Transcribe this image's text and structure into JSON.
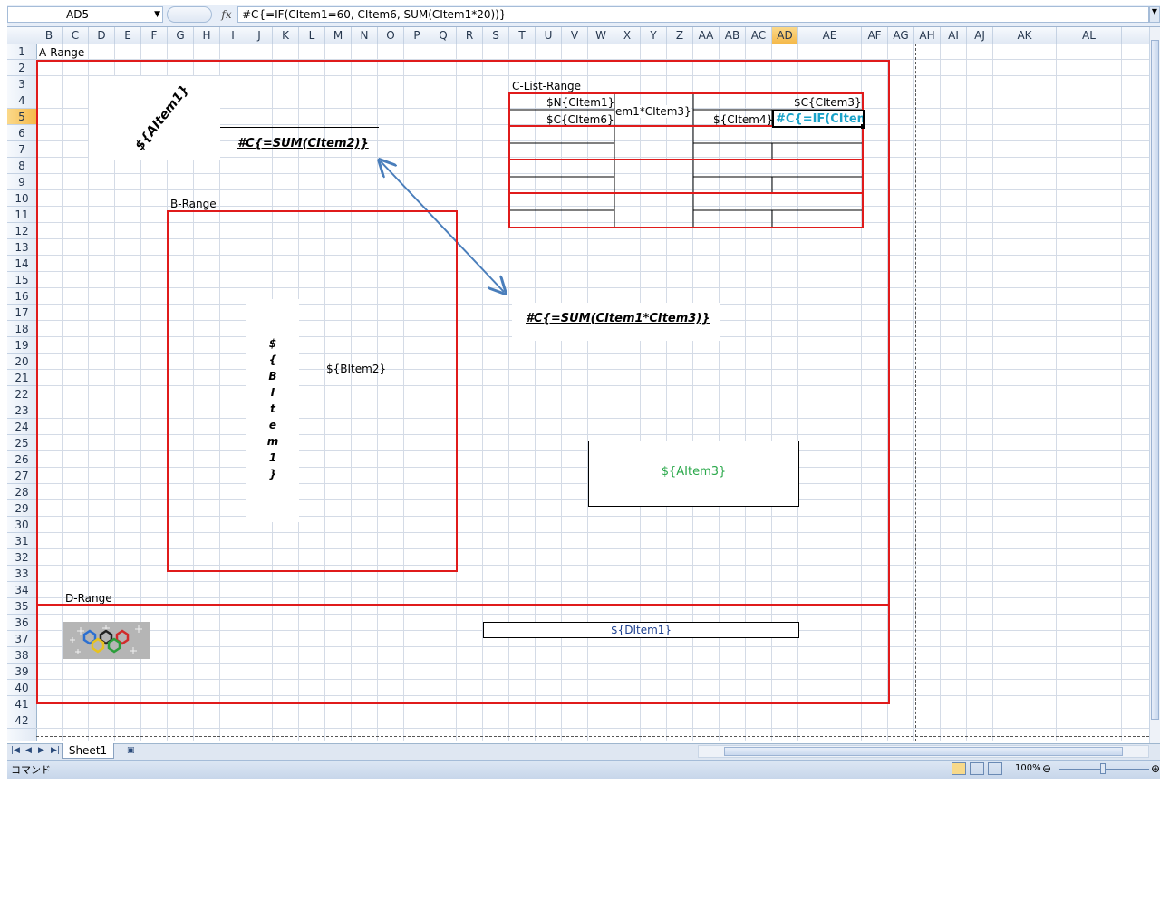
{
  "formula_bar": {
    "name_box": "AD5",
    "fx": "fx",
    "formula": "#C{=IF(CItem1=60, CItem6, SUM(CItem1*20))}"
  },
  "columns": [
    "B",
    "C",
    "D",
    "E",
    "F",
    "G",
    "H",
    "I",
    "J",
    "K",
    "L",
    "M",
    "N",
    "O",
    "P",
    "Q",
    "R",
    "S",
    "T",
    "U",
    "V",
    "W",
    "X",
    "Y",
    "Z",
    "AA",
    "AB",
    "AC",
    "AD",
    "AE",
    "AF",
    "AG",
    "AH",
    "AI",
    "AJ",
    "AK",
    "AL"
  ],
  "selected_column": "AD",
  "rows": [
    "1",
    "2",
    "3",
    "4",
    "5",
    "6",
    "7",
    "8",
    "9",
    "10",
    "11",
    "12",
    "13",
    "14",
    "15",
    "16",
    "17",
    "18",
    "19",
    "20",
    "21",
    "22",
    "23",
    "24",
    "25",
    "26",
    "27",
    "28",
    "29",
    "30",
    "31",
    "32",
    "33",
    "34",
    "35",
    "36",
    "37",
    "38",
    "39",
    "40",
    "41",
    "42"
  ],
  "selected_row": "5",
  "labels": {
    "a_range": "A-Range",
    "c_list_range": "C-List-Range",
    "b_range": "B-Range",
    "d_range": "D-Range"
  },
  "cells": {
    "aitem1": "${AItem1}",
    "sum_citem2": "#C{=SUM(CItem2)}",
    "n_citem1": "$N{CItem1}",
    "c_citem6": "$C{CItem6}",
    "merged_item": "em1*CItem3}",
    "c_citem3": "$C{CItem3}",
    "citem4": "${CItem4}",
    "active_formula": "#C{=IF(CItem",
    "sum_citem1_citem3": "#C{=SUM(CItem1*CItem3)}",
    "bitem1_chars": [
      "$",
      "{",
      "B",
      "I",
      "t",
      "e",
      "m",
      "1",
      "}"
    ],
    "bitem2": "${BItem2}",
    "aitem3": "${AItem3}",
    "ditem1": "${DItem1}"
  },
  "sheet_tabs": [
    "Sheet1"
  ],
  "status": {
    "mode": "コマンド",
    "zoom": "100%"
  },
  "colors": {
    "range_border": "#e01b1b",
    "aitem3_text": "#2aa84a",
    "ditem1_text": "#1c3f8f",
    "active_cell_text": "#1aa3c9",
    "arrow": "#4a7ebb"
  }
}
